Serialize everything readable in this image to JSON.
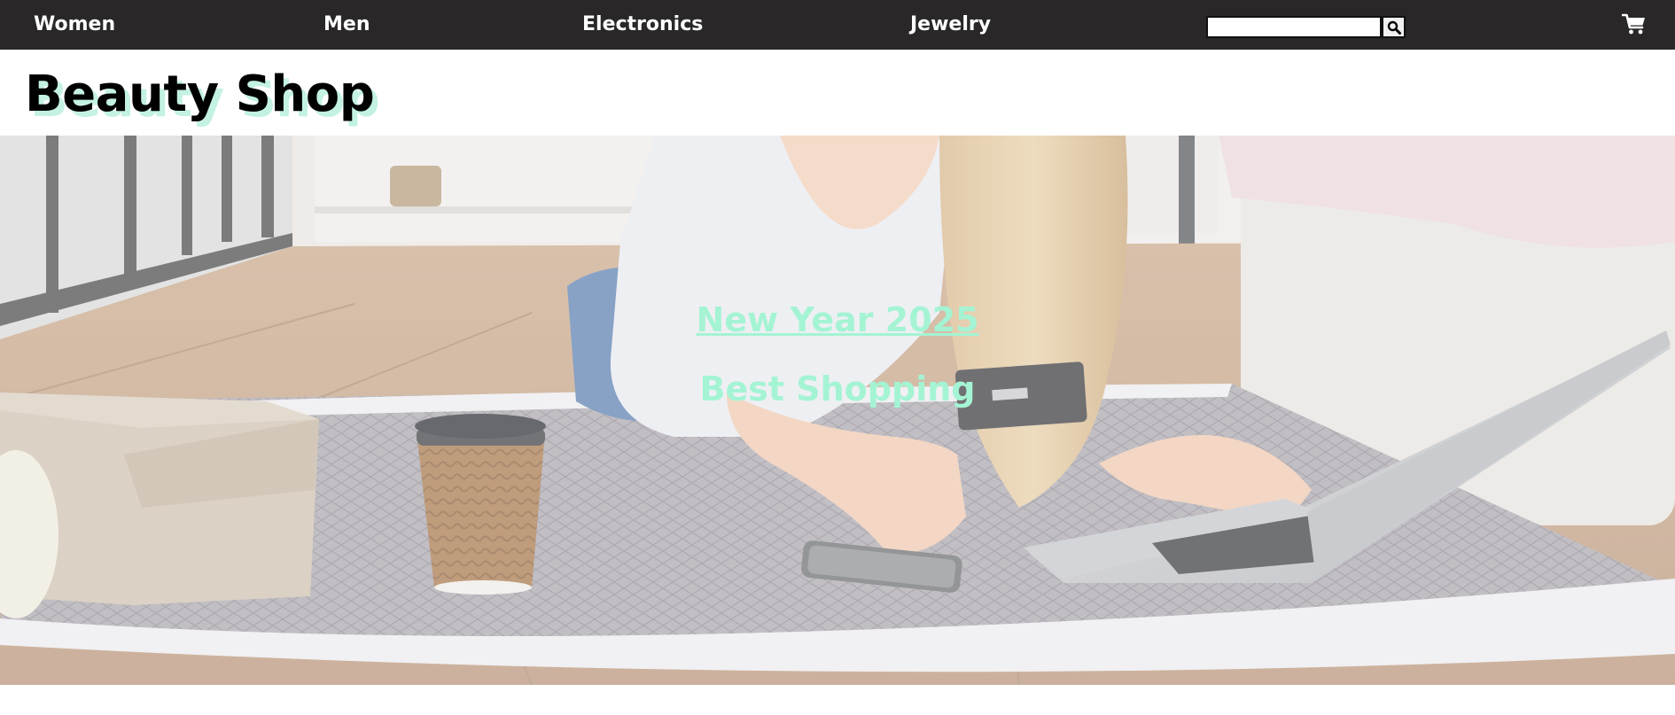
{
  "nav": {
    "items": [
      {
        "label": "Women"
      },
      {
        "label": "Men"
      },
      {
        "label": "Electronics"
      },
      {
        "label": "Jewelry"
      }
    ],
    "search": {
      "value": "",
      "placeholder": "",
      "button_icon": "search-icon"
    },
    "cart_icon": "shopping-cart-icon"
  },
  "logo": {
    "text": "Beauty Shop"
  },
  "hero": {
    "title": "New Year 2025",
    "subtitle": "Best Shopping",
    "image": "woman-shopping-online-with-laptop-and-credit-card"
  },
  "colors": {
    "nav_bg": "#292728",
    "nav_text": "#ffffff",
    "logo_shadow": "#c3f2e2",
    "hero_text": "#a4f4d4"
  }
}
